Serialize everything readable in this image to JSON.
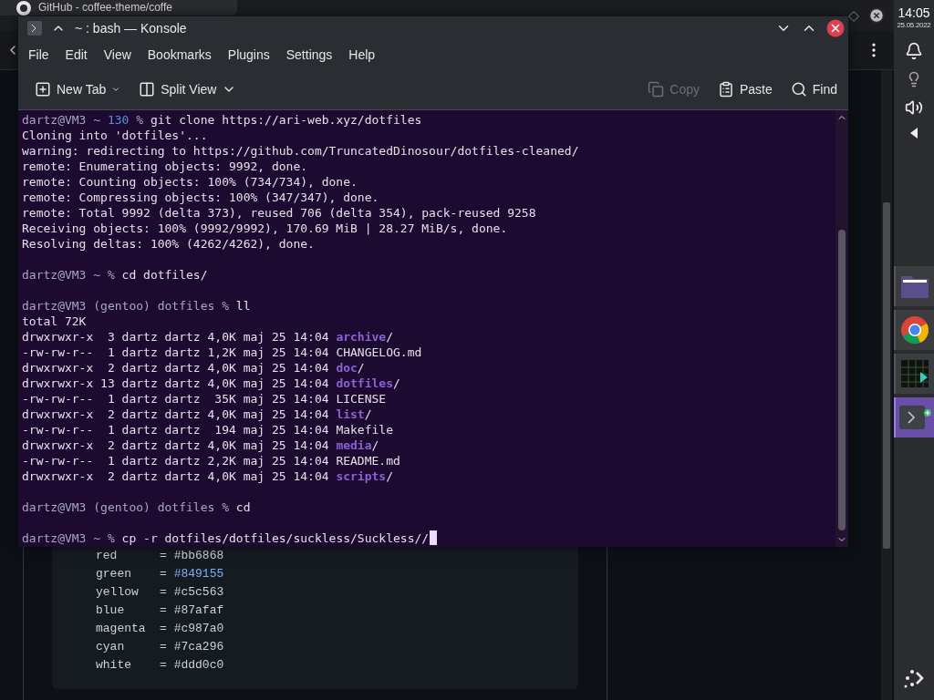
{
  "browser": {
    "tab": {
      "title": "GitHub - coffee-theme/coffe"
    },
    "code_lines": [
      {
        "key": "red",
        "op": "=",
        "value": "#bb6868",
        "highlighted": false
      },
      {
        "key": "green",
        "op": "=",
        "value": "#849155",
        "highlighted": true
      },
      {
        "key": "yellow",
        "op": "=",
        "value": "#c5c563",
        "highlighted": false
      },
      {
        "key": "blue",
        "op": "=",
        "value": "#87afaf",
        "highlighted": false
      },
      {
        "key": "magenta",
        "op": "=",
        "value": "#c987a0",
        "highlighted": false
      },
      {
        "key": "cyan",
        "op": "=",
        "value": "#7ca296",
        "highlighted": false
      },
      {
        "key": "white",
        "op": "=",
        "value": "#ddd0c0",
        "highlighted": false
      }
    ]
  },
  "window": {
    "title": "~ : bash — Konsole",
    "menu": [
      "File",
      "Edit",
      "View",
      "Bookmarks",
      "Plugins",
      "Settings",
      "Help"
    ],
    "toolbar_left": [
      {
        "kind": "new-tab",
        "label": "New Tab"
      },
      {
        "kind": "split-view",
        "label": "Split View"
      }
    ],
    "toolbar_right": [
      {
        "kind": "copy",
        "label": "Copy",
        "disabled": true
      },
      {
        "kind": "paste",
        "label": "Paste",
        "disabled": false
      },
      {
        "kind": "find",
        "label": "Find",
        "disabled": false
      }
    ],
    "terminal_lines": [
      {
        "kind": "prompt",
        "prompt": "dartz@VM3 ~",
        "exit_code": "130",
        "symbol": "%",
        "command": "git clone https://ari-web.xyz/dotfiles"
      },
      {
        "kind": "output",
        "text": "Cloning into 'dotfiles'..."
      },
      {
        "kind": "output",
        "text": "warning: redirecting to https://github.com/TruncatedDinosour/dotfiles-cleaned/"
      },
      {
        "kind": "output",
        "text": "remote: Enumerating objects: 9992, done."
      },
      {
        "kind": "output",
        "text": "remote: Counting objects: 100% (734/734), done."
      },
      {
        "kind": "output",
        "text": "remote: Compressing objects: 100% (347/347), done."
      },
      {
        "kind": "output",
        "text": "remote: Total 9992 (delta 373), reused 706 (delta 354), pack-reused 9258"
      },
      {
        "kind": "output",
        "text": "Receiving objects: 100% (9992/9992), 170.69 MiB | 28.27 MiB/s, done."
      },
      {
        "kind": "output",
        "text": "Resolving deltas: 100% (4262/4262), done."
      },
      {
        "kind": "blank"
      },
      {
        "kind": "prompt",
        "prompt": "dartz@VM3 ~",
        "symbol": "%",
        "command": "cd dotfiles/"
      },
      {
        "kind": "blank"
      },
      {
        "kind": "prompt",
        "prompt": "dartz@VM3 (gentoo) dotfiles",
        "symbol": "%",
        "command": "ll"
      },
      {
        "kind": "output",
        "text": "total 72K"
      },
      {
        "kind": "entry",
        "meta": "drwxrwxr-x  3 dartz dartz 4,0K maj 25 14:04",
        "name": "archive",
        "suffix": "/",
        "directory": true
      },
      {
        "kind": "entry",
        "meta": "-rw-rw-r--  1 dartz dartz 1,2K maj 25 14:04",
        "name": "CHANGELOG.md",
        "directory": false
      },
      {
        "kind": "entry",
        "meta": "drwxrwxr-x  2 dartz dartz 4,0K maj 25 14:04",
        "name": "doc",
        "suffix": "/",
        "directory": true
      },
      {
        "kind": "entry",
        "meta": "drwxrwxr-x 13 dartz dartz 4,0K maj 25 14:04",
        "name": "dotfiles",
        "suffix": "/",
        "directory": true
      },
      {
        "kind": "entry",
        "meta": "-rw-rw-r--  1 dartz dartz  35K maj 25 14:04",
        "name": "LICENSE",
        "directory": false
      },
      {
        "kind": "entry",
        "meta": "drwxrwxr-x  2 dartz dartz 4,0K maj 25 14:04",
        "name": "list",
        "suffix": "/",
        "directory": true
      },
      {
        "kind": "entry",
        "meta": "-rw-rw-r--  1 dartz dartz  194 maj 25 14:04",
        "name": "Makefile",
        "directory": false
      },
      {
        "kind": "entry",
        "meta": "drwxrwxr-x  2 dartz dartz 4,0K maj 25 14:04",
        "name": "media",
        "suffix": "/",
        "directory": true
      },
      {
        "kind": "entry",
        "meta": "-rw-rw-r--  1 dartz dartz 2,2K maj 25 14:04",
        "name": "README.md",
        "directory": false
      },
      {
        "kind": "entry",
        "meta": "drwxrwxr-x  2 dartz dartz 4,0K maj 25 14:04",
        "name": "scripts",
        "suffix": "/",
        "directory": true
      },
      {
        "kind": "blank"
      },
      {
        "kind": "prompt",
        "prompt": "dartz@VM3 (gentoo) dotfiles",
        "symbol": "%",
        "command": "cd"
      },
      {
        "kind": "blank"
      },
      {
        "kind": "prompt",
        "prompt": "dartz@VM3 ~",
        "symbol": "%",
        "command": "cp -r dotfiles/dotfiles/suckless/Suckless//",
        "cursor": true
      }
    ]
  },
  "panel": {
    "time": "14:05",
    "date": "25.05.2022",
    "tasks": [
      {
        "kind": "folder",
        "selected": false
      },
      {
        "kind": "browser",
        "selected": false
      },
      {
        "kind": "monitor",
        "selected": false
      },
      {
        "kind": "terminal",
        "selected": true
      }
    ]
  }
}
